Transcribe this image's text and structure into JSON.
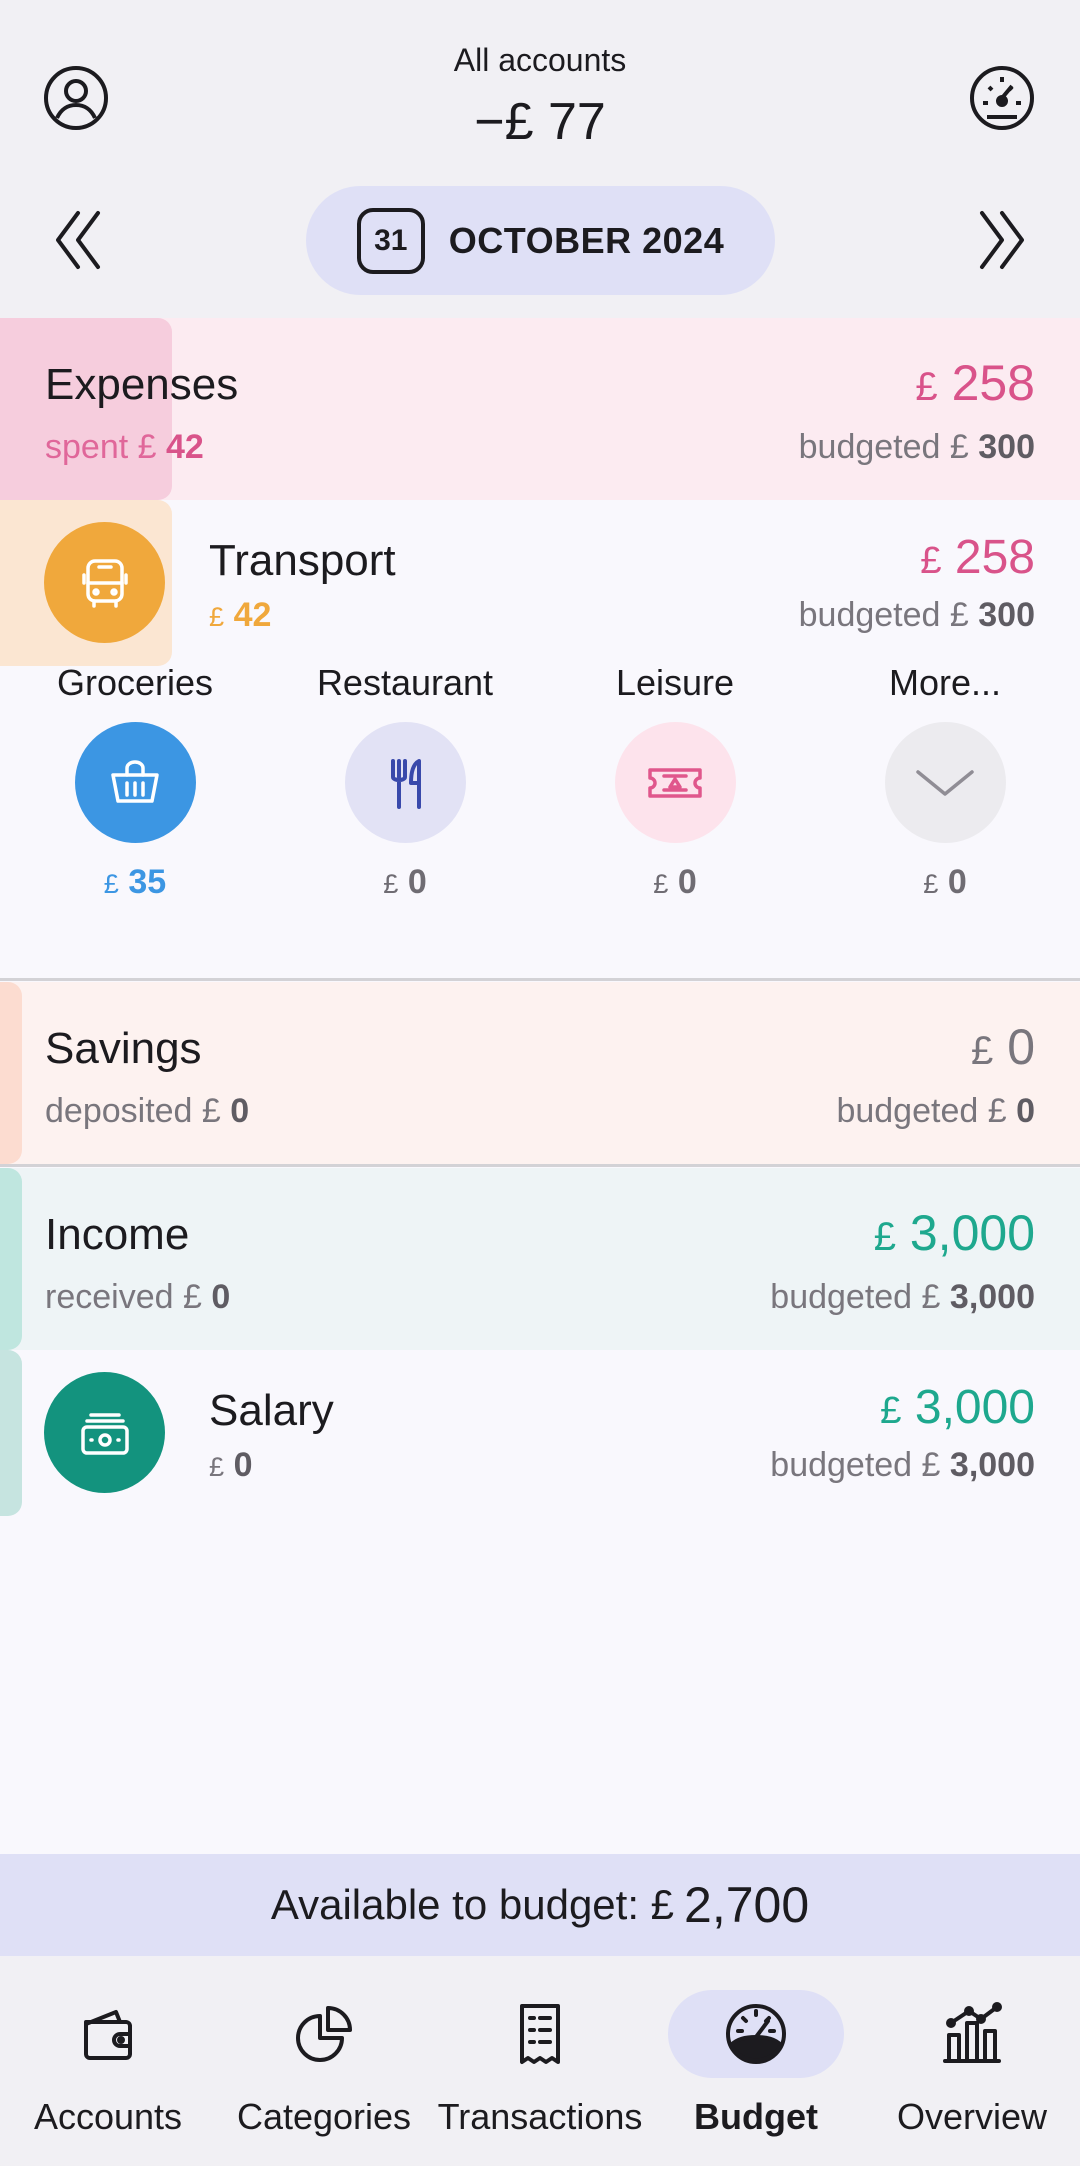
{
  "header": {
    "title": "All accounts",
    "total": "−£ 77",
    "month_day": "31",
    "month": "OCTOBER 2024"
  },
  "expenses": {
    "title": "Expenses",
    "spent_label": "spent £",
    "spent_value": "42",
    "amount_symbol": "£",
    "amount": "258",
    "budgeted_label": "budgeted £",
    "budgeted_value": "300"
  },
  "transport": {
    "title": "Transport",
    "spent_symbol": "£",
    "spent_value": "42",
    "amount_symbol": "£",
    "amount": "258",
    "budgeted_label": "budgeted £",
    "budgeted_value": "300",
    "icon": "bus-icon"
  },
  "quick_categories": [
    {
      "label": "Groceries",
      "symbol": "£",
      "amount": "35",
      "icon": "basket-icon"
    },
    {
      "label": "Restaurant",
      "symbol": "£",
      "amount": "0",
      "icon": "cutlery-icon"
    },
    {
      "label": "Leisure",
      "symbol": "£",
      "amount": "0",
      "icon": "ticket-icon"
    },
    {
      "label": "More...",
      "symbol": "£",
      "amount": "0",
      "icon": "chevron-down-icon"
    }
  ],
  "savings": {
    "title": "Savings",
    "deposited_label": "deposited £",
    "deposited_value": "0",
    "amount_symbol": "£",
    "amount": "0",
    "budgeted_label": "budgeted £",
    "budgeted_value": "0"
  },
  "income": {
    "title": "Income",
    "received_label": "received £",
    "received_value": "0",
    "amount_symbol": "£",
    "amount": "3,000",
    "budgeted_label": "budgeted £",
    "budgeted_value": "3,000"
  },
  "salary": {
    "title": "Salary",
    "received_symbol": "£",
    "received_value": "0",
    "amount_symbol": "£",
    "amount": "3,000",
    "budgeted_label": "budgeted £",
    "budgeted_value": "3,000",
    "icon": "cash-icon"
  },
  "available": {
    "label": "Available to budget: £",
    "amount": "2,700"
  },
  "nav": [
    {
      "label": "Accounts",
      "icon": "wallet-icon"
    },
    {
      "label": "Categories",
      "icon": "pie-chart-icon"
    },
    {
      "label": "Transactions",
      "icon": "receipt-icon"
    },
    {
      "label": "Budget",
      "icon": "gauge-icon",
      "active": true
    },
    {
      "label": "Overview",
      "icon": "bar-chart-icon"
    }
  ],
  "colors": {
    "expense": "#d9538a",
    "transport": "#f0a83c",
    "groceries": "#3c96e3",
    "income": "#1ea88e",
    "nav_active_bg": "#dfe0f6"
  }
}
